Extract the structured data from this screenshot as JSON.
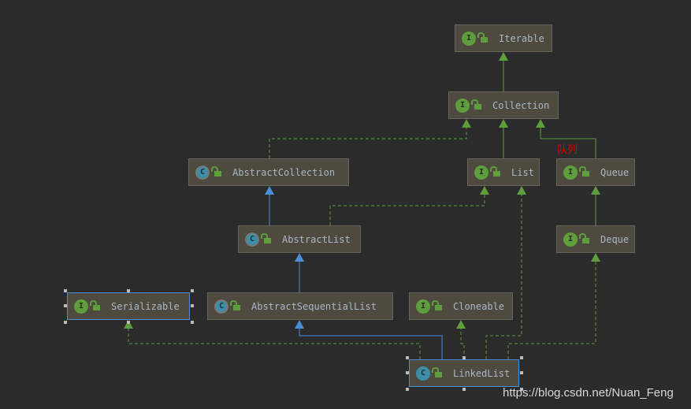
{
  "nodes": [
    {
      "id": "iterable",
      "name": "Iterable",
      "kind": "interface"
    },
    {
      "id": "collection",
      "name": "Collection",
      "kind": "interface"
    },
    {
      "id": "abstractcollection",
      "name": "AbstractCollection",
      "kind": "abstract-class"
    },
    {
      "id": "list",
      "name": "List",
      "kind": "interface"
    },
    {
      "id": "queue",
      "name": "Queue",
      "kind": "interface"
    },
    {
      "id": "abstractlist",
      "name": "AbstractList",
      "kind": "abstract-class"
    },
    {
      "id": "deque",
      "name": "Deque",
      "kind": "interface"
    },
    {
      "id": "serializable",
      "name": "Serializable",
      "kind": "interface",
      "selected": true
    },
    {
      "id": "abstractsequentiallist",
      "name": "AbstractSequentialList",
      "kind": "abstract-class"
    },
    {
      "id": "cloneable",
      "name": "Cloneable",
      "kind": "interface"
    },
    {
      "id": "linkedlist",
      "name": "LinkedList",
      "kind": "class",
      "selected": true
    }
  ],
  "edges": [
    {
      "from": "collection",
      "to": "iterable",
      "type": "extends-interface"
    },
    {
      "from": "list",
      "to": "collection",
      "type": "extends-interface"
    },
    {
      "from": "queue",
      "to": "collection",
      "type": "extends-interface"
    },
    {
      "from": "abstractcollection",
      "to": "collection",
      "type": "implements"
    },
    {
      "from": "abstractlist",
      "to": "abstractcollection",
      "type": "extends-class"
    },
    {
      "from": "abstractlist",
      "to": "list",
      "type": "implements"
    },
    {
      "from": "deque",
      "to": "queue",
      "type": "extends-interface"
    },
    {
      "from": "abstractsequentiallist",
      "to": "abstractlist",
      "type": "extends-class"
    },
    {
      "from": "linkedlist",
      "to": "abstractsequentiallist",
      "type": "extends-class"
    },
    {
      "from": "linkedlist",
      "to": "serializable",
      "type": "implements"
    },
    {
      "from": "linkedlist",
      "to": "cloneable",
      "type": "implements"
    },
    {
      "from": "linkedlist",
      "to": "list",
      "type": "implements"
    },
    {
      "from": "linkedlist",
      "to": "deque",
      "type": "implements"
    }
  ],
  "badges": {
    "interface": "I",
    "class": "C",
    "abstract-class": "C"
  },
  "annotation": "队列",
  "watermark": "https://blog.csdn.net/Nuan_Feng",
  "colors": {
    "interface_edge": "#5e9e3c",
    "class_edge": "#4b8ed6",
    "annotation": "#e00000"
  }
}
